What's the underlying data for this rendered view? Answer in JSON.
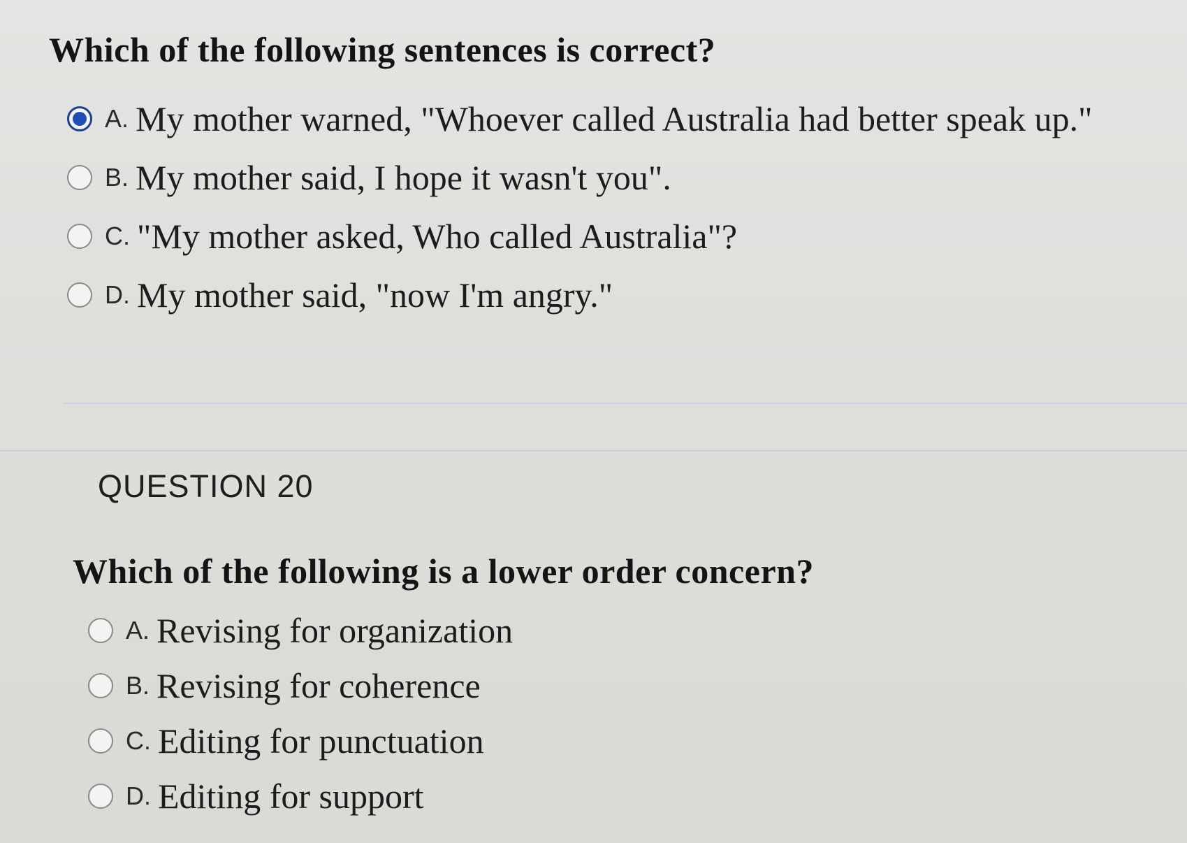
{
  "question19": {
    "text": "Which of the following sentences is correct?",
    "selected": "A",
    "options": [
      {
        "letter": "A.",
        "text": "My mother warned, \"Whoever called Australia had better speak up.\""
      },
      {
        "letter": "B.",
        "text": "My mother said, I hope it wasn't you\"."
      },
      {
        "letter": "C.",
        "text": "\"My mother asked, Who called Australia\"?"
      },
      {
        "letter": "D.",
        "text": "My mother said, \"now I'm angry.\""
      }
    ]
  },
  "question20": {
    "number": "QUESTION 20",
    "text": "Which of the following is a lower order concern?",
    "options": [
      {
        "letter": "A.",
        "text": "Revising for organization"
      },
      {
        "letter": "B.",
        "text": "Revising for coherence"
      },
      {
        "letter": "C.",
        "text": "Editing for punctuation"
      },
      {
        "letter": "D.",
        "text": "Editing for support"
      }
    ]
  },
  "colors": {
    "selected_radio": "#1f4fb6",
    "divider": "#c7d3e0",
    "background": "#dededb"
  }
}
